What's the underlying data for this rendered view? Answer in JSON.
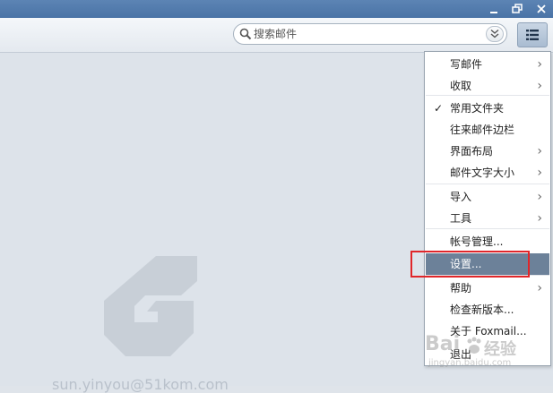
{
  "search": {
    "placeholder": "搜索邮件"
  },
  "menu": {
    "items": [
      {
        "label": "写邮件",
        "submenu": true,
        "checked": false
      },
      {
        "label": "收取",
        "submenu": true,
        "checked": false
      },
      {
        "label": "常用文件夹",
        "submenu": false,
        "checked": true
      },
      {
        "label": "往来邮件边栏",
        "submenu": false,
        "checked": false
      },
      {
        "label": "界面布局",
        "submenu": true,
        "checked": false
      },
      {
        "label": "邮件文字大小",
        "submenu": true,
        "checked": false
      },
      {
        "label": "导入",
        "submenu": true,
        "checked": false
      },
      {
        "label": "工具",
        "submenu": true,
        "checked": false
      },
      {
        "label": "帐号管理...",
        "submenu": false,
        "checked": false
      },
      {
        "label": "设置...",
        "submenu": false,
        "checked": false,
        "selected": true
      },
      {
        "label": "帮助",
        "submenu": true,
        "checked": false
      },
      {
        "label": "检查新版本...",
        "submenu": false,
        "checked": false
      },
      {
        "label": "关于 Foxmail...",
        "submenu": false,
        "checked": false
      },
      {
        "label": "退出",
        "submenu": false,
        "checked": false
      }
    ],
    "check_glyph": "✓",
    "arrow_glyph": "›"
  },
  "account": {
    "email": "sun.yinyou@51kom.com"
  },
  "watermark": {
    "brand": "Bai",
    "suffix": "经验",
    "url": "jingyan.baidu.com"
  },
  "colors": {
    "titlebar": "#4f78aa",
    "menu_selected": "#6c8199",
    "highlight_box": "#e0262a"
  }
}
